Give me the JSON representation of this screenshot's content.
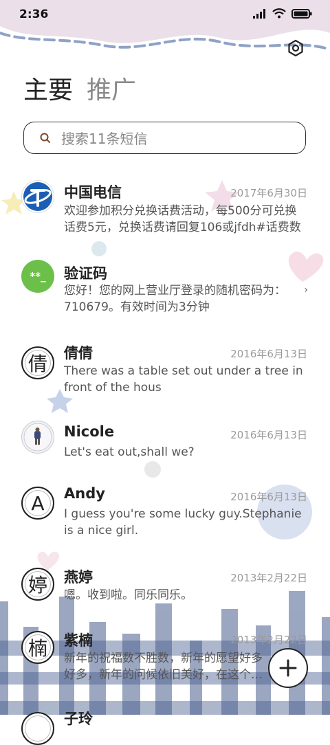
{
  "status_bar": {
    "time": "2:36"
  },
  "tabs": [
    {
      "label": "主要",
      "active": true
    },
    {
      "label": "推广",
      "active": false
    }
  ],
  "search": {
    "placeholder": "搜索11条短信"
  },
  "messages": [
    {
      "name": "中国电信",
      "date": "2017年6月30日",
      "preview": "欢迎参加积分兑换话费活动，每500分可兑换话费5元，兑换话费请回复106或jfdh#话费数",
      "avatar": "telecom-logo"
    },
    {
      "name": "验证码",
      "date": "",
      "preview": "您好！您的网上营业厅登录的随机密码为：710679。有效时间为3分钟",
      "avatar": "code",
      "avatar_text": "**_"
    },
    {
      "name": "倩倩",
      "date": "2016年6月13日",
      "preview": "There was a table set out under a tree in front of the hous",
      "avatar": "letter",
      "avatar_text": "倩"
    },
    {
      "name": "Nicole",
      "date": "2016年6月13日",
      "preview": "Let's eat out,shall we?",
      "avatar": "photo"
    },
    {
      "name": "Andy",
      "date": "2016年6月13日",
      "preview": "I guess you're some lucky guy.Stephanie is a nice girl.",
      "avatar": "letter",
      "avatar_text": "A"
    },
    {
      "name": "燕婷",
      "date": "2013年2月22日",
      "preview": "嗯。收到啦。同乐同乐。",
      "avatar": "letter",
      "avatar_text": "婷"
    },
    {
      "name": "紫楠",
      "date": "2013年2月22日",
      "preview": "新年的祝福数不胜数，新年的愿望好多好多，新年的问候依旧美好，在这个温馨的时刻",
      "avatar": "letter",
      "avatar_text": "楠"
    },
    {
      "name": "子玲",
      "date": "",
      "preview": "",
      "avatar": "letter",
      "avatar_text": ""
    }
  ],
  "colors": {
    "accent_blue": "#8a9bc4",
    "wave_pink": "#ece0ea",
    "code_green": "#6cc04a",
    "telecom_blue": "#1a5fb4"
  },
  "icons": {
    "settings": "settings-icon",
    "search": "search-icon",
    "fab": "plus-icon",
    "chevron": "chevron-right-icon"
  }
}
